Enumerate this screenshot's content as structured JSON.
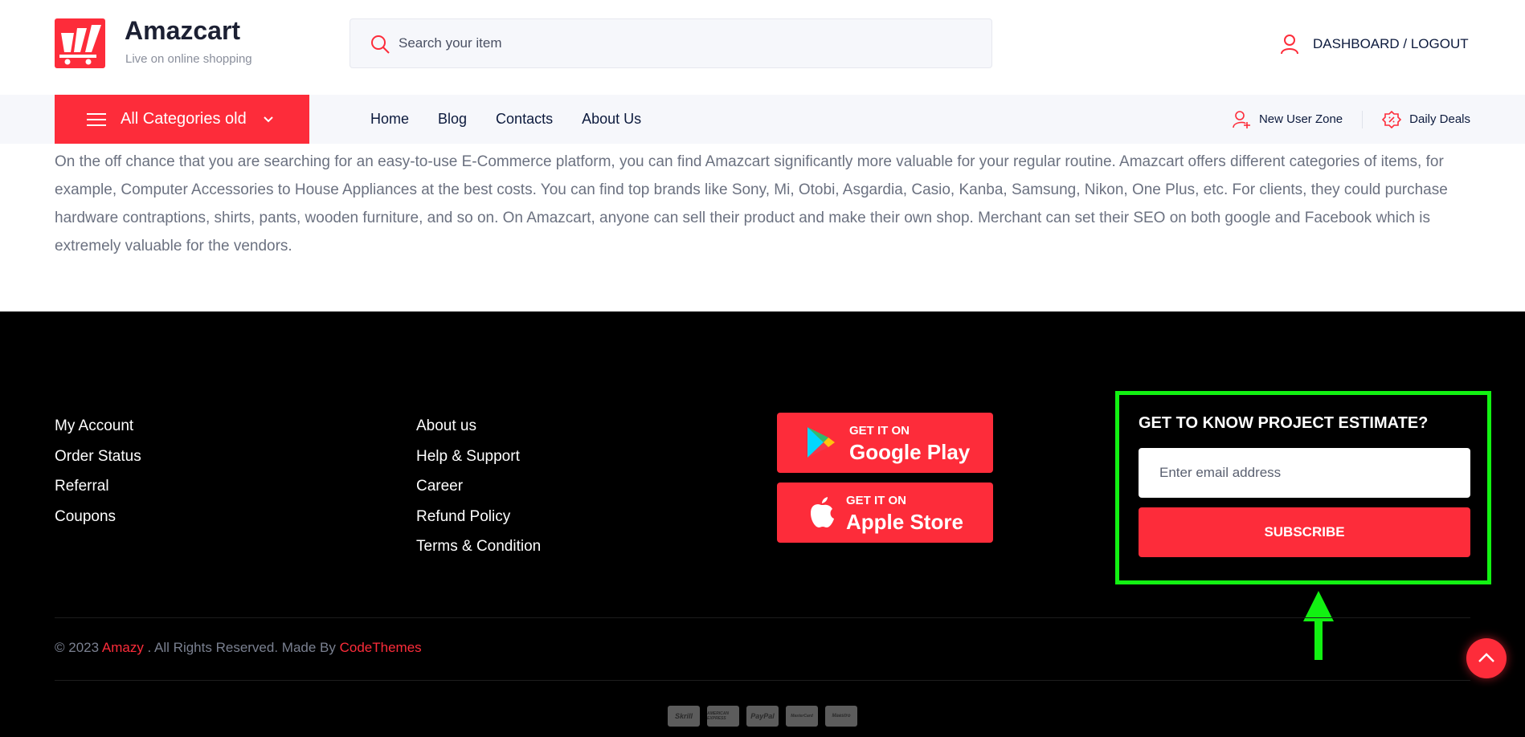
{
  "colors": {
    "accent": "#fd2c3a",
    "highlight_box": "#12f112"
  },
  "header": {
    "logo_title": "Amazcart",
    "logo_subtitle": "Live on online shopping",
    "search_placeholder": "Search your item",
    "account_link": "DASHBOARD / LOGOUT"
  },
  "nav": {
    "all_categories": "All Categories old",
    "links": [
      "Home",
      "Blog",
      "Contacts",
      "About Us"
    ],
    "new_user_zone": "New User Zone",
    "daily_deals": "Daily Deals"
  },
  "about": {
    "text": "On the off chance that you are searching for an easy-to-use  E-Commerce platform, you can find Amazcart significantly more valuable for your regular routine. Amazcart offers different categories of items, for example, Computer Accessories to House Appliances at the best costs. You can find top brands like Sony, Mi, Otobi, Asgardia, Casio, Kanba, Samsung, Nikon, One Plus, etc. For clients, they could purchase hardware contraptions, shirts, pants, wooden furniture, and so on. On Amazcart, anyone can sell their product and make their own shop. Merchant can set their SEO on both google and Facebook which is extremely valuable for the vendors."
  },
  "footer": {
    "col1": [
      "My Account",
      "Order Status",
      "Referral",
      "Coupons"
    ],
    "col2": [
      "About us",
      "Help & Support",
      "Career",
      "Refund Policy",
      "Terms & Condition"
    ],
    "google_play": {
      "small": "GET IT ON",
      "big": "Google Play"
    },
    "apple_store": {
      "small": "GET IT ON",
      "big": "Apple Store"
    },
    "estimate_title": "GET TO KNOW PROJECT ESTIMATE?",
    "email_placeholder": "Enter email address",
    "subscribe_label": "SUBSCRIBE",
    "copyright_prefix": "© 2023 ",
    "copyright_brand": "Amazy",
    "copyright_middle": " . All Rights Reserved. Made By ",
    "copyright_maker": "CodeThemes",
    "payments": [
      "Skrill",
      "AMERICAN EXPRESS",
      "PayPal",
      "MasterCard",
      "Maestro"
    ]
  }
}
